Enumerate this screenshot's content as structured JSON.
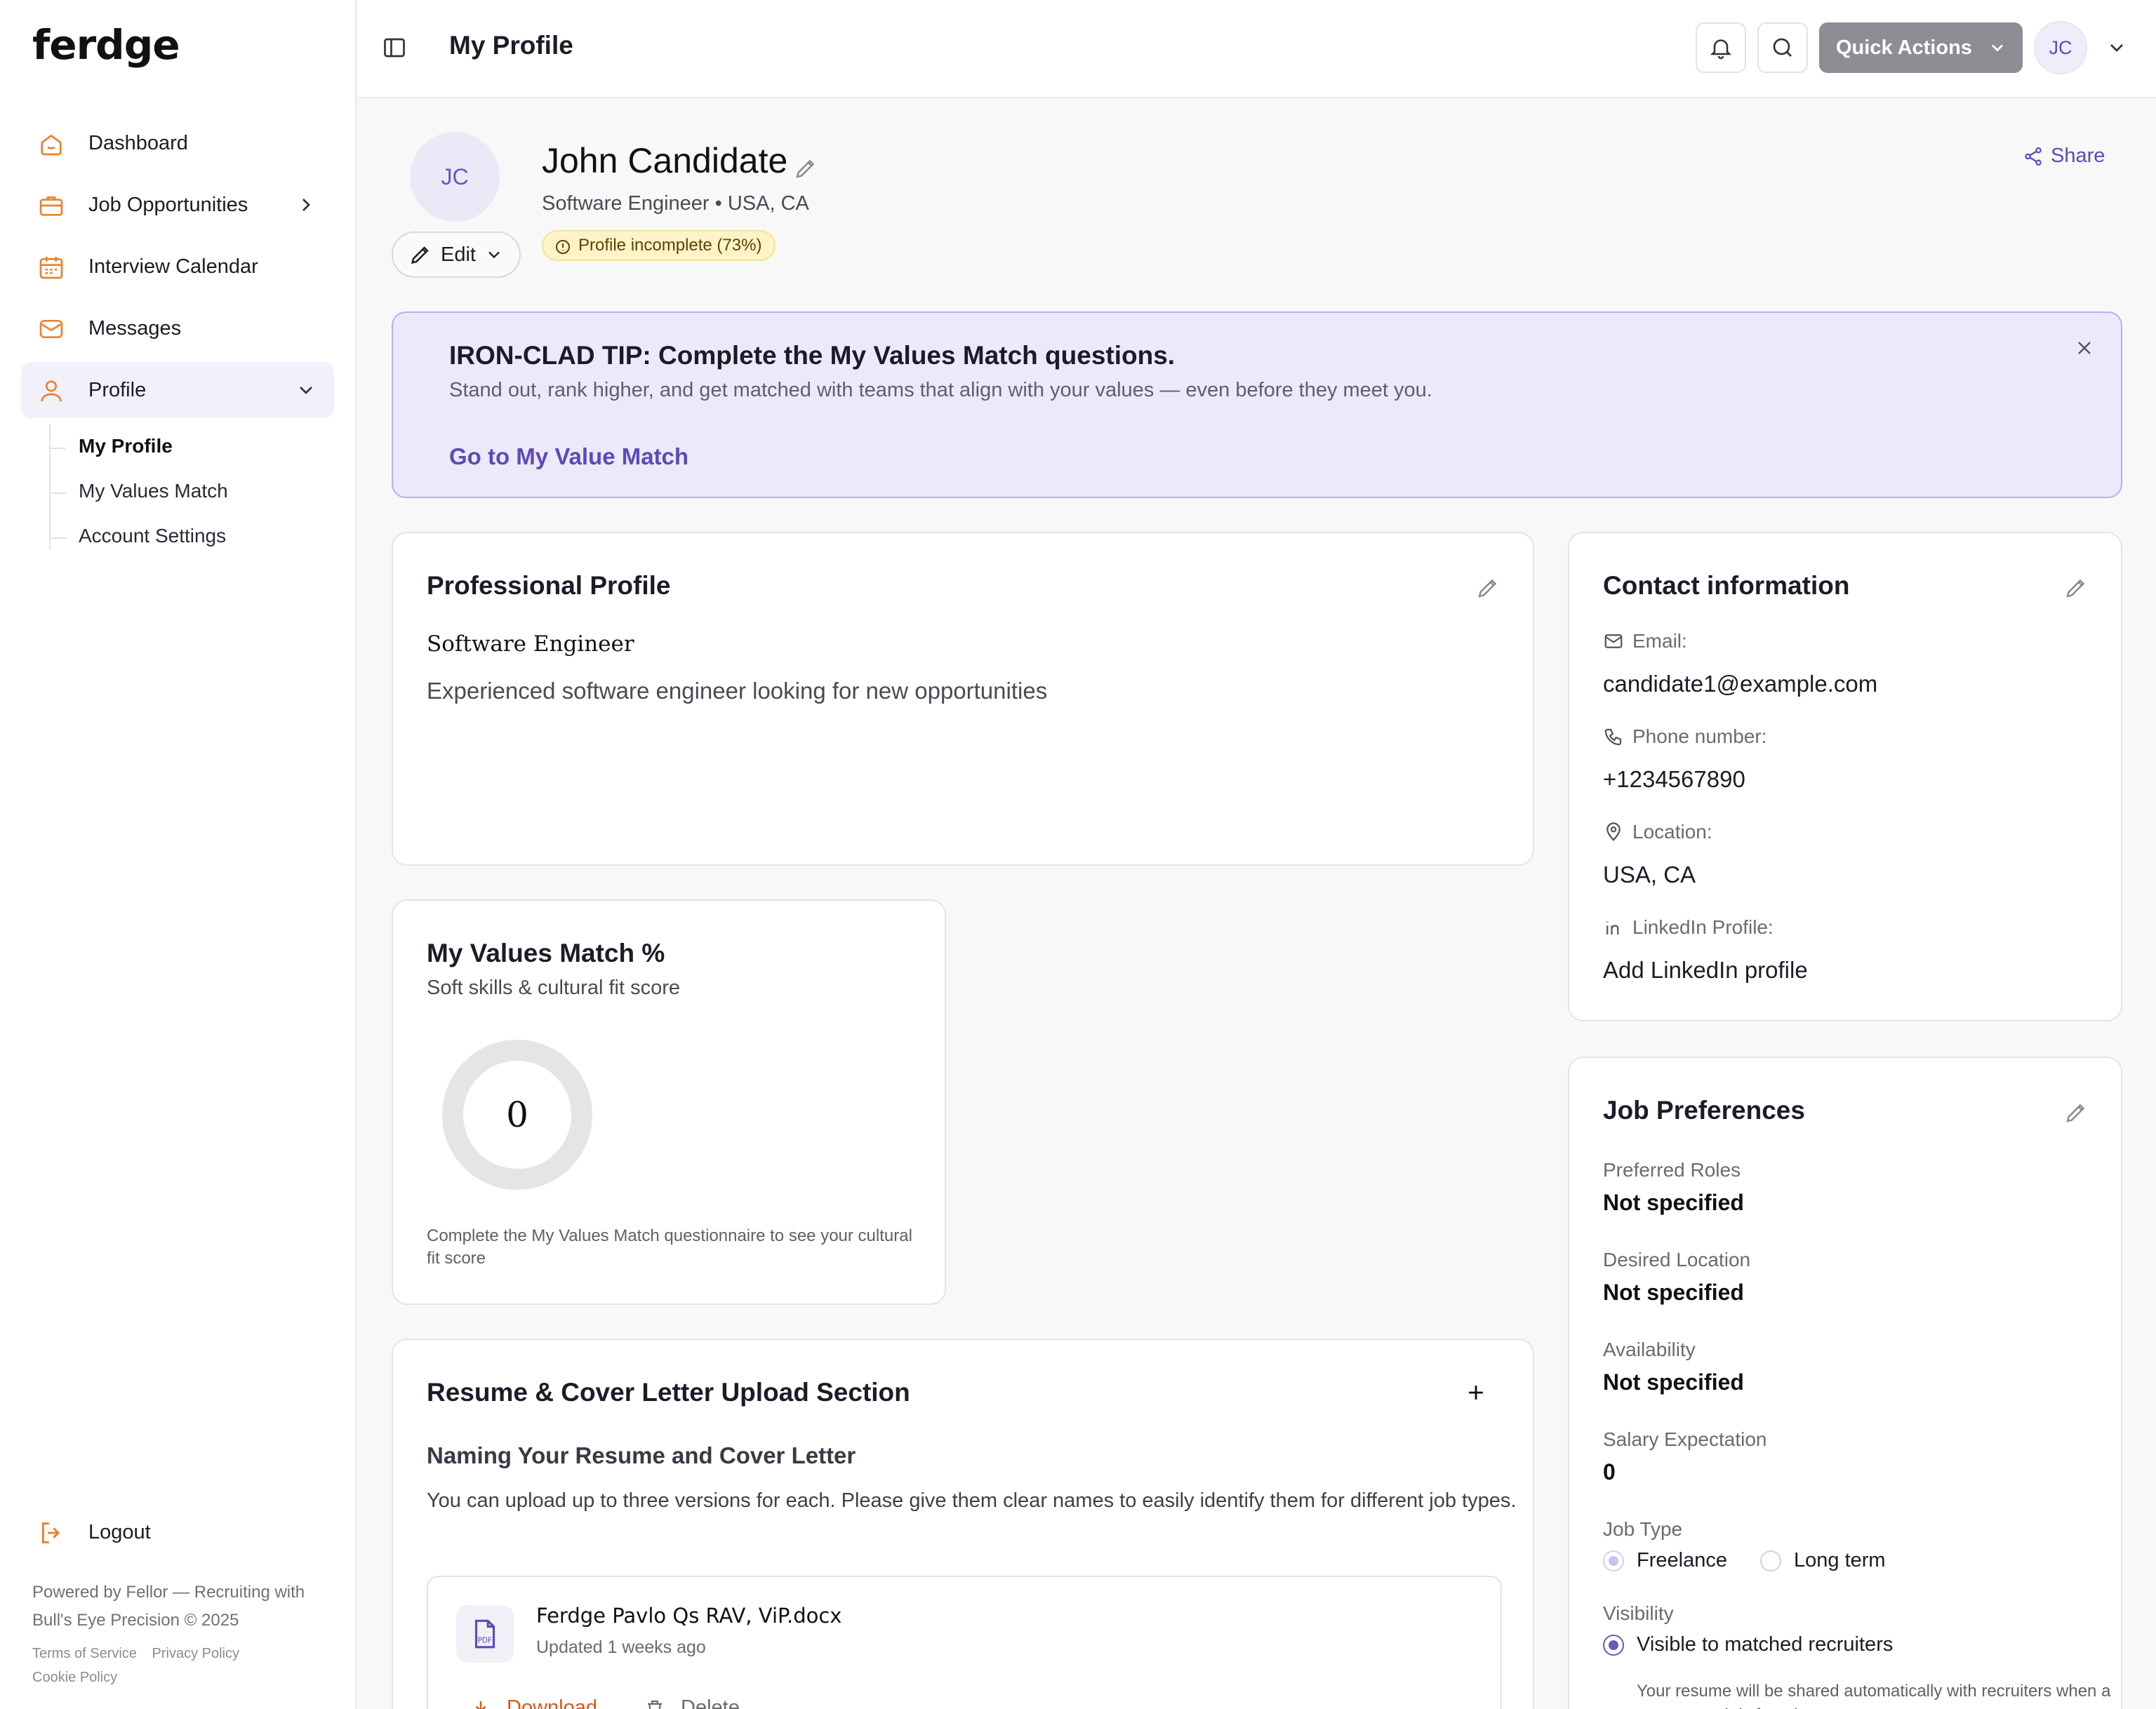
{
  "brand": {
    "logo": "ferdge"
  },
  "sidebar": {
    "items": [
      {
        "label": "Dashboard",
        "icon": "home-icon"
      },
      {
        "label": "Job Opportunities",
        "icon": "briefcase-icon"
      },
      {
        "label": "Interview Calendar",
        "icon": "calendar-icon"
      },
      {
        "label": "Messages",
        "icon": "mail-icon"
      },
      {
        "label": "Profile",
        "icon": "user-icon"
      }
    ],
    "sub_items": [
      "My Profile",
      "My Values Match",
      "Account Settings"
    ],
    "logout": "Logout",
    "footer": "Powered by Fellor — Recruiting with Bull's Eye Precision © 2025",
    "footer_links": [
      "Terms of Service",
      "Privacy Policy",
      "Cookie Policy"
    ],
    "accent_color": "#e8822c"
  },
  "topbar": {
    "title": "My Profile",
    "quick_actions": "Quick Actions",
    "avatar_initials": "JC"
  },
  "profile": {
    "initials": "JC",
    "name": "John Candidate",
    "subtitle": "Software Engineer • USA, CA",
    "edit_label": "Edit",
    "badge": "Profile incomplete (73%)",
    "completion_percent": 73,
    "share_label": "Share"
  },
  "tip": {
    "title": "IRON-CLAD TIP: Complete the My Values Match questions.",
    "text": "Stand out, rank higher, and get matched with teams that align with your values — even before they meet you.",
    "link": "Go to My Value Match"
  },
  "professional_profile": {
    "title": "Professional Profile",
    "role": "Software Engineer",
    "description": "Experienced software engineer looking for new opportunities"
  },
  "values_match": {
    "title": "My Values Match %",
    "subtitle": "Soft skills & cultural fit score",
    "score": "0",
    "hint": "Complete the My Values Match questionnaire to see your cultural fit score"
  },
  "resume": {
    "title": "Resume & Cover Letter Upload Section",
    "heading": "Naming Your Resume and Cover Letter",
    "text": "You can upload up to three versions for each. Please give them clear names to easily identify them for different job types.",
    "file": {
      "name": "Ferdge Pavlo Qs RAV, ViP.docx",
      "updated": "Updated 1 weeks ago",
      "icon_label": "PDF",
      "download": "Download",
      "delete": "Delete"
    }
  },
  "contact": {
    "title": "Contact information",
    "email_label": "Email:",
    "email": "candidate1@example.com",
    "phone_label": "Phone number:",
    "phone": "+1234567890",
    "location_label": "Location:",
    "location": "USA, CA",
    "linkedin_label": "LinkedIn Profile:",
    "linkedin": "Add LinkedIn profile"
  },
  "job_preferences": {
    "title": "Job Preferences",
    "roles_label": "Preferred Roles",
    "roles": "Not specified",
    "location_label": "Desired Location",
    "location": "Not specified",
    "availability_label": "Availability",
    "availability": "Not specified",
    "salary_label": "Salary Expectation",
    "salary": "0",
    "job_type_label": "Job Type",
    "job_type_options": [
      "Freelance",
      "Long term"
    ],
    "visibility_label": "Visibility",
    "visibility_option": "Visible to matched recruiters",
    "visibility_note": "Your resume will be shared automatically with recruiters when a strong match is found."
  }
}
